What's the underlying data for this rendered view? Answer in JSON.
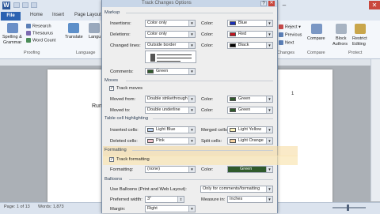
{
  "word": {
    "file_tab": "File",
    "tabs": [
      "Home",
      "Insert",
      "Page Layout"
    ],
    "ribbon_left": {
      "spelling": "Spelling &",
      "grammar": "Grammar",
      "research": "Research",
      "thesaurus": "Thesaurus",
      "word_count": "Word Count",
      "proofing": "Proofing",
      "translate": "Translate",
      "language_btn": "Langu",
      "language_group": "Language"
    },
    "ribbon_right": {
      "reject": "Reject",
      "previous": "Previous",
      "next": "Next",
      "changes": "Changes",
      "compare": "Compare",
      "compare_group": "Compare",
      "block": "Block",
      "authors": "Authors",
      "restrict": "Restrict",
      "editing": "Editing",
      "protect": "Protect"
    },
    "page_text": "Rumi",
    "page_number": "1",
    "status": {
      "page": "Page: 1 of 13",
      "words": "Words: 1,873"
    }
  },
  "dialog": {
    "title": "Track Changes Options",
    "help": "?",
    "close": "✕",
    "markup": {
      "section": "Markup",
      "insertions_label": "Insertions:",
      "insertions_value": "Color only",
      "deletions_label": "Deletions:",
      "deletions_value": "Color only",
      "changed_lines_label": "Changed lines:",
      "changed_lines_value": "Outside border",
      "comments_label": "Comments:",
      "comments_value": "Green",
      "color_label": "Color:",
      "ins_color": "Blue",
      "del_color": "Red",
      "lines_color": "Black"
    },
    "moves": {
      "section": "Moves",
      "track_moves": "Track moves",
      "moved_from_label": "Moved from:",
      "moved_from_value": "Double strikethrough",
      "moved_to_label": "Moved to:",
      "moved_to_value": "Double underline",
      "color_label": "Color:",
      "from_color": "Green",
      "to_color": "Green"
    },
    "table": {
      "section": "Table cell highlighting",
      "inserted_label": "Inserted cells:",
      "inserted_value": "Light Blue",
      "deleted_label": "Deleted cells:",
      "deleted_value": "Pink",
      "merged_label": "Merged cells:",
      "merged_value": "Light Yellow",
      "split_label": "Split cells:",
      "split_value": "Light Orange"
    },
    "formatting": {
      "section": "Formatting",
      "track_formatting": "Track formatting",
      "formatting_label": "Formatting:",
      "formatting_value": "(none)",
      "color_label": "Color:",
      "color_value": "Green"
    },
    "balloons": {
      "section": "Balloons",
      "use_label": "Use Balloons (Print and Web Layout):",
      "use_value": "Only for comments/formatting",
      "width_label": "Preferred width:",
      "width_value": "3\"",
      "measure_label": "Measure in:",
      "measure_value": "Inches",
      "margin_label": "Margin:",
      "margin_value": "Right"
    }
  },
  "colors": {
    "blue": "#1a2fb8",
    "red": "#c1121f",
    "black": "#000000",
    "green": "#2f5a2c",
    "light_blue": "#bcd3f2",
    "pink": "#f2c4cf",
    "light_yellow": "#fbf3bd",
    "light_orange": "#f7d3a3"
  }
}
